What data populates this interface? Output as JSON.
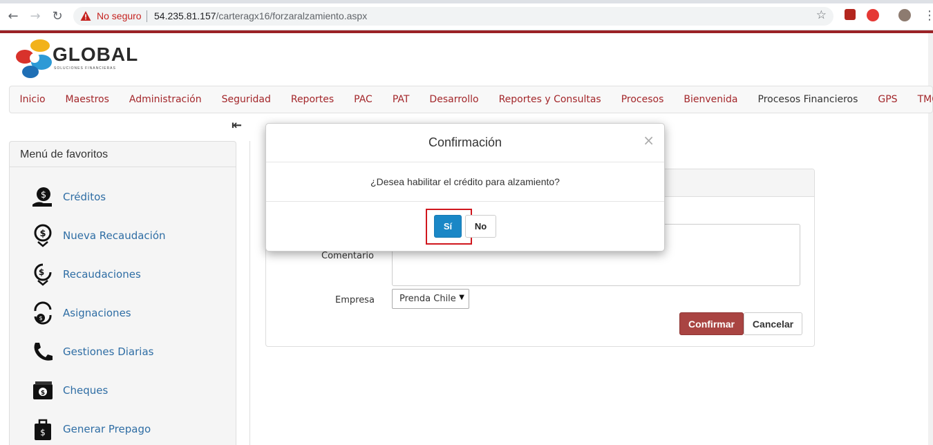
{
  "browser": {
    "security_label": "No seguro",
    "url_host": "54.235.81.157",
    "url_path": "/carteragx16/forzaralzamiento.aspx"
  },
  "logo": {
    "name": "GLOBAL",
    "tagline": "SOLUCIONES FINANCIERAS"
  },
  "menu": {
    "items": [
      "Inicio",
      "Maestros",
      "Administración",
      "Seguridad",
      "Reportes",
      "PAC",
      "PAT",
      "Desarrollo",
      "Reportes y Consultas",
      "Procesos",
      "Bienvenida",
      "Procesos Financieros",
      "GPS",
      "TMC"
    ]
  },
  "sidebar": {
    "title": "Menú de favoritos",
    "items": [
      {
        "label": "Créditos",
        "icon": "credit-hand-icon"
      },
      {
        "label": "Nueva Recaudación",
        "icon": "new-collection-icon"
      },
      {
        "label": "Recaudaciones",
        "icon": "collections-icon"
      },
      {
        "label": "Asignaciones",
        "icon": "assignments-icon"
      },
      {
        "label": "Gestiones Diarias",
        "icon": "phone-icon"
      },
      {
        "label": "Cheques",
        "icon": "cheque-icon"
      },
      {
        "label": "Generar Prepago",
        "icon": "prepay-bag-icon"
      }
    ]
  },
  "form": {
    "comment_label": "Comentario",
    "comment_value": "",
    "company_label": "Empresa",
    "company_value": "Prenda Chile",
    "confirm_label": "Confirmar",
    "cancel_label": "Cancelar"
  },
  "modal": {
    "title": "Confirmación",
    "close": "×",
    "message": "¿Desea habilitar el crédito para alzamiento?",
    "yes_label": "Sí",
    "no_label": "No"
  },
  "colors": {
    "brand_red": "#a3262a",
    "link_blue": "#2e6da4",
    "primary_blue": "#1a87c6",
    "danger": "#a94442",
    "highlight": "#d0161d"
  }
}
